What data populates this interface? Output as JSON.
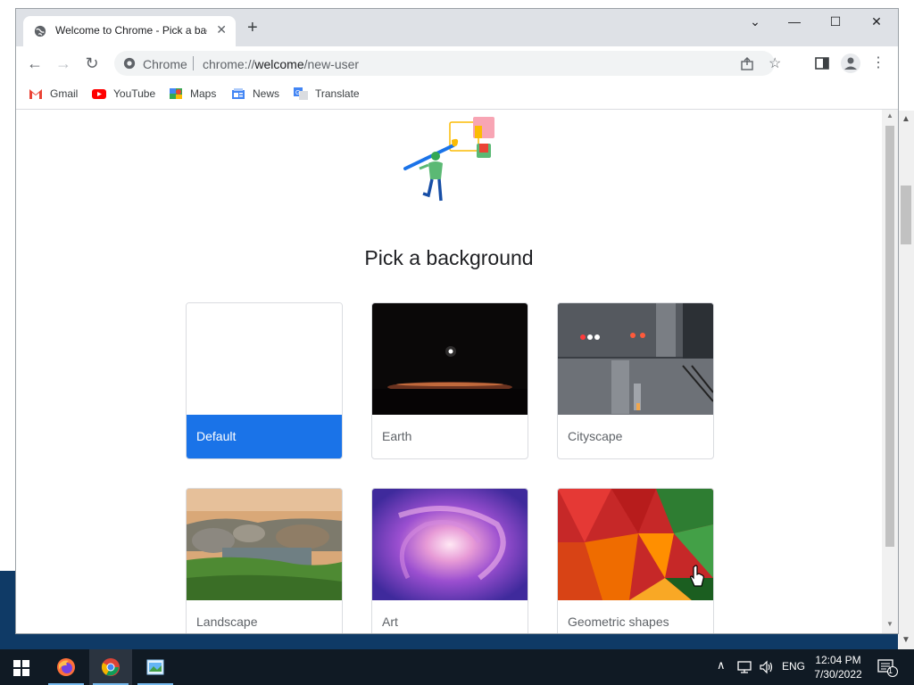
{
  "browser": {
    "tab_title": "Welcome to Chrome - Pick a background",
    "new_tab_label": "+",
    "omnibox": {
      "site_label": "Chrome",
      "url_prefix": "chrome://",
      "url_host": "welcome",
      "url_path": "/new-user"
    }
  },
  "bookmarks": [
    {
      "label": "Gmail",
      "icon": "gmail-icon"
    },
    {
      "label": "YouTube",
      "icon": "youtube-icon"
    },
    {
      "label": "Maps",
      "icon": "maps-icon"
    },
    {
      "label": "News",
      "icon": "news-icon"
    },
    {
      "label": "Translate",
      "icon": "translate-icon"
    }
  ],
  "page": {
    "heading": "Pick a background",
    "backgrounds": [
      {
        "label": "Default",
        "selected": true
      },
      {
        "label": "Earth",
        "selected": false
      },
      {
        "label": "Cityscape",
        "selected": false
      },
      {
        "label": "Landscape",
        "selected": false
      },
      {
        "label": "Art",
        "selected": false
      },
      {
        "label": "Geometric shapes",
        "selected": false
      }
    ]
  },
  "taskbar": {
    "language": "ENG",
    "time": "12:04 PM",
    "date": "7/30/2022",
    "notification_count": "1"
  },
  "colors": {
    "accent": "#1a73e8",
    "taskbar": "#101a24"
  }
}
